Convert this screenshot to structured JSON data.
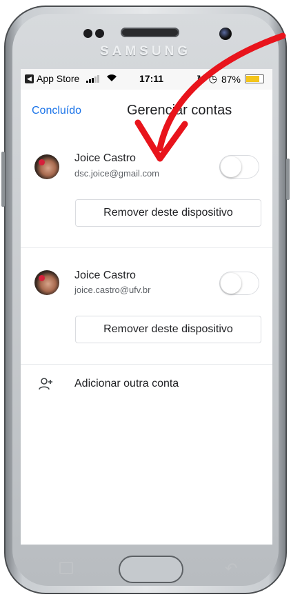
{
  "device": {
    "brand": "SAMSUNG"
  },
  "status_bar": {
    "back_app": "App Store",
    "time": "17:11",
    "battery": "87%",
    "battery_level": 0.87,
    "colors": {
      "battery_fill": "#f4c51b"
    }
  },
  "nav": {
    "done_label": "Concluído",
    "title": "Gerenciar contas"
  },
  "accounts": [
    {
      "name": "Joice Castro",
      "email": "dsc.joice@gmail.com",
      "toggle_on": false,
      "remove_label": "Remover deste dispositivo"
    },
    {
      "name": "Joice Castro",
      "email": "joice.castro@ufv.br",
      "toggle_on": false,
      "remove_label": "Remover deste dispositivo"
    }
  ],
  "add_account": {
    "label": "Adicionar outra conta",
    "icon": "person-add-icon"
  },
  "annotation": {
    "arrow_color": "#e8141c"
  },
  "accent_color": "#1a73e8"
}
